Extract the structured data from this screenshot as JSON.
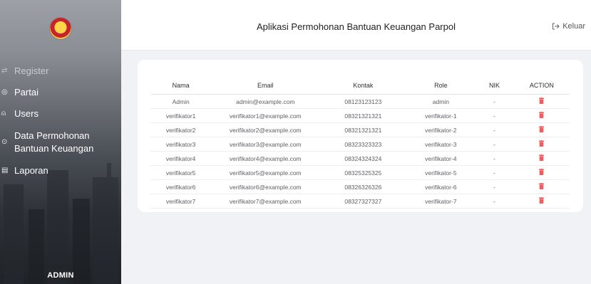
{
  "sidebar": {
    "brand": "logo",
    "items": [
      {
        "label": "Register",
        "icon": "register-icon",
        "glyph": "⇄"
      },
      {
        "label": "Partai",
        "icon": "partai-icon",
        "glyph": "◎"
      },
      {
        "label": "Users",
        "icon": "users-icon",
        "glyph": "⍝"
      },
      {
        "label_line1": "Data Permohonan",
        "label_line2": "Bantuan Keuangan",
        "icon": "data-icon",
        "glyph": "⊙"
      },
      {
        "label": "Laporan",
        "icon": "laporan-icon",
        "glyph": "▤"
      }
    ],
    "footer": "ADMIN"
  },
  "header": {
    "title": "Aplikasi Permohonan Bantuan Keuangan Parpol",
    "logout_label": "Keluar",
    "logout_icon": "logout-icon"
  },
  "table": {
    "columns": [
      "Nama",
      "Email",
      "Kontak",
      "Role",
      "NIK",
      "ACTION"
    ],
    "rows": [
      {
        "nama": "Admin",
        "email": "admin@example.com",
        "kontak": "08123123123",
        "role": "admin",
        "nik": "-"
      },
      {
        "nama": "verifikator1",
        "email": "verifikator1@example.com",
        "kontak": "08321321321",
        "role": "verifikator-1",
        "nik": "-"
      },
      {
        "nama": "verifikator2",
        "email": "verifikator2@example.com",
        "kontak": "08321321321",
        "role": "verifikator-2",
        "nik": "-"
      },
      {
        "nama": "verifikator3",
        "email": "verifikator3@example.com",
        "kontak": "08323323323",
        "role": "verifikator-3",
        "nik": "-"
      },
      {
        "nama": "verifikator4",
        "email": "verifikator4@example.com",
        "kontak": "08324324324",
        "role": "verifikator-4",
        "nik": "-"
      },
      {
        "nama": "verifikator5",
        "email": "verifikator5@example.com",
        "kontak": "08325325325",
        "role": "verifikator-5",
        "nik": "-"
      },
      {
        "nama": "verifikator6",
        "email": "verifikator6@example.com",
        "kontak": "08326326326",
        "role": "verifikator-6",
        "nik": "-"
      },
      {
        "nama": "verifikator7",
        "email": "verifikator7@example.com",
        "kontak": "08327327327",
        "role": "verifikator-7",
        "nik": "-"
      }
    ],
    "action_icon": "trash-icon"
  },
  "colors": {
    "accent_delete": "#f25c5c",
    "sidebar_bg": "#2e3238",
    "page_bg": "#f1f2f5"
  }
}
